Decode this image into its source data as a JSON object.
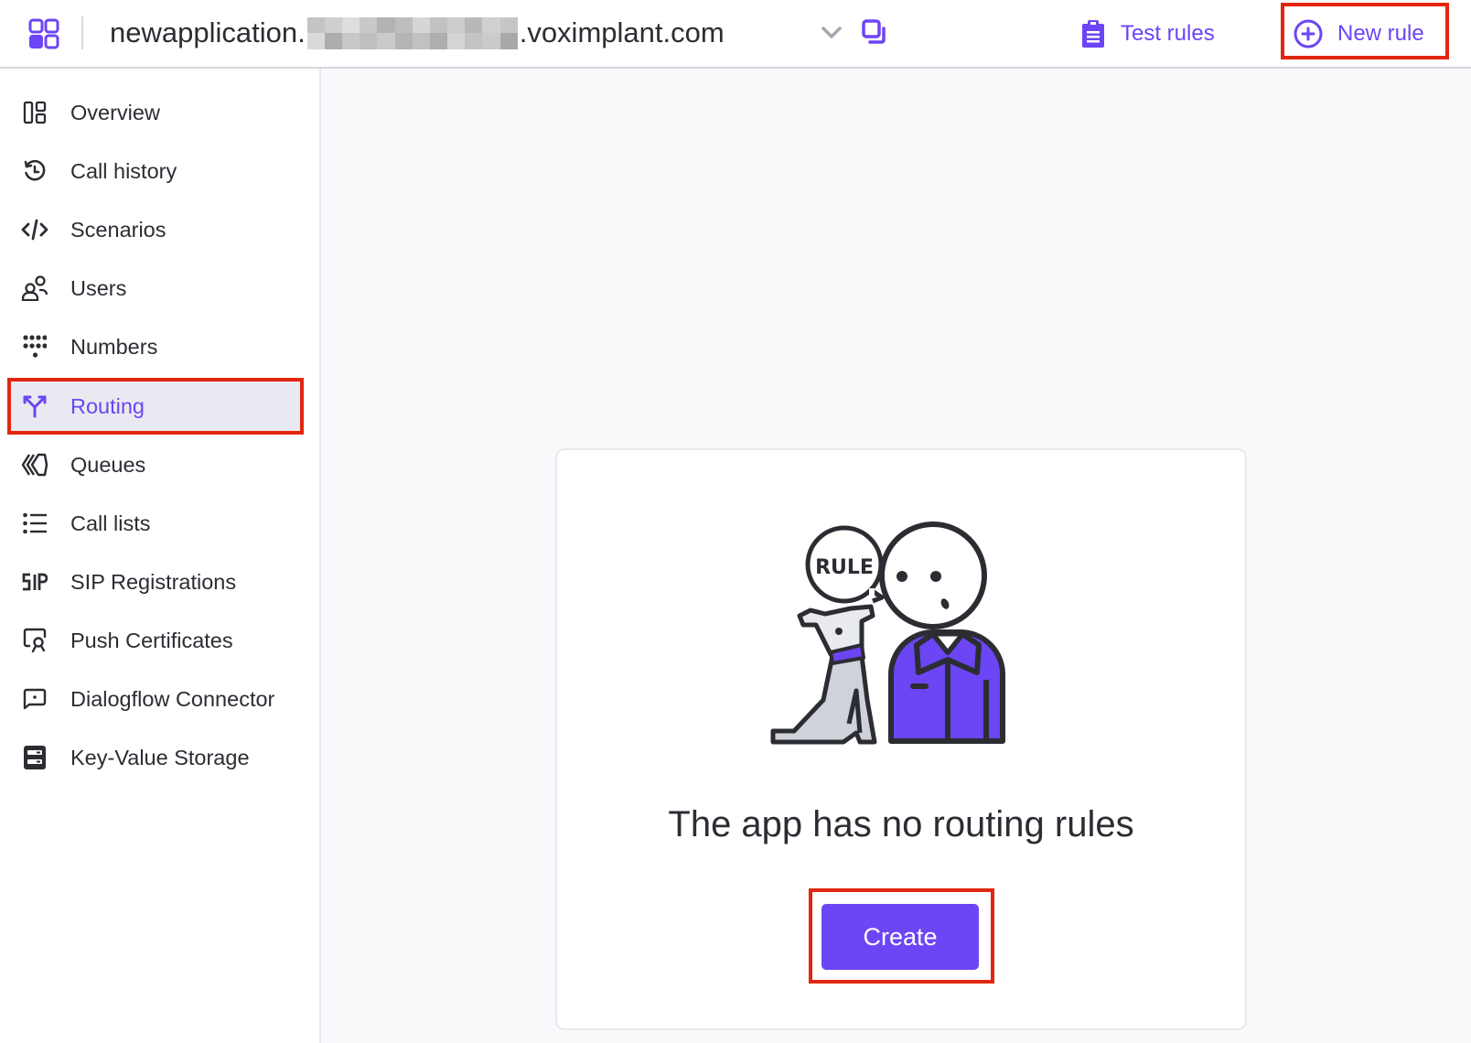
{
  "header": {
    "app_name_prefix": "newapplication.",
    "app_name_suffix": ".voximplant.com",
    "redacted_segment": "pixelated",
    "test_rules_label": "Test rules",
    "new_rule_label": "New rule"
  },
  "sidebar": {
    "items": [
      {
        "label": "Overview",
        "icon": "overview-icon"
      },
      {
        "label": "Call history",
        "icon": "history-icon"
      },
      {
        "label": "Scenarios",
        "icon": "code-icon"
      },
      {
        "label": "Users",
        "icon": "users-icon"
      },
      {
        "label": "Numbers",
        "icon": "dialpad-icon"
      },
      {
        "label": "Routing",
        "icon": "routing-icon",
        "active": true
      },
      {
        "label": "Queues",
        "icon": "queues-icon"
      },
      {
        "label": "Call lists",
        "icon": "list-icon"
      },
      {
        "label": "SIP Registrations",
        "icon": "sip-icon"
      },
      {
        "label": "Push Certificates",
        "icon": "certificate-icon"
      },
      {
        "label": "Dialogflow Connector",
        "icon": "chat-icon"
      },
      {
        "label": "Key-Value Storage",
        "icon": "storage-icon"
      }
    ]
  },
  "empty_state": {
    "bubble_text": "RULE",
    "title": "The app has no routing rules",
    "create_label": "Create"
  },
  "colors": {
    "accent": "#6c45f5",
    "highlight_box": "#e2260f",
    "text": "#2b2d33",
    "active_bg": "#e9eaf1"
  }
}
